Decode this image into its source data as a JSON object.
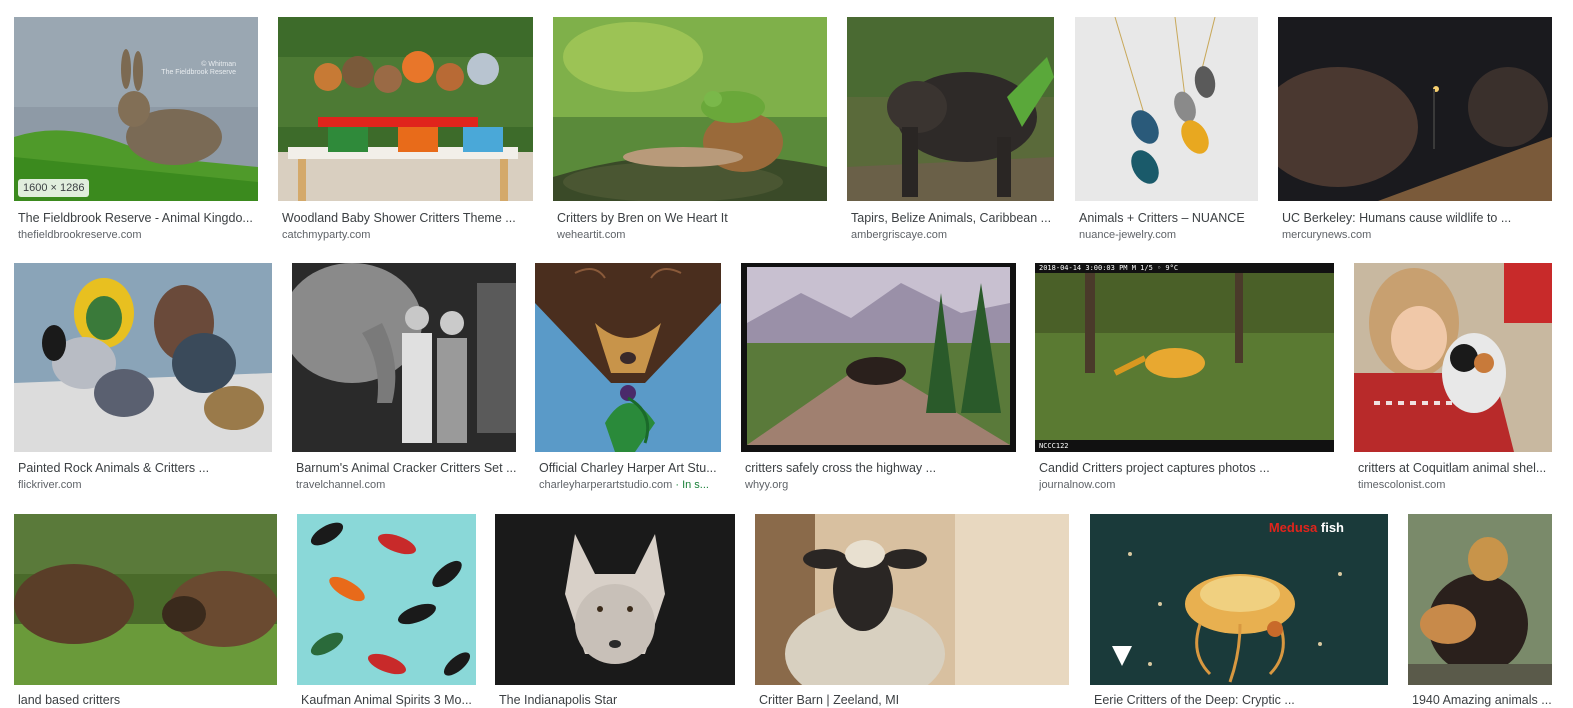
{
  "results": [
    {
      "title": "The Fieldbrook Reserve - Animal Kingdo...",
      "source": "thefieldbrookreserve.com",
      "badge": "1600 × 1286"
    },
    {
      "title": "Woodland Baby Shower Critters Theme ...",
      "source": "catchmyparty.com"
    },
    {
      "title": "Critters by Bren on We Heart It",
      "source": "weheartit.com"
    },
    {
      "title": "Tapirs, Belize Animals, Caribbean ...",
      "source": "ambergriscaye.com"
    },
    {
      "title": "Animals + Critters – NUANCE",
      "source": "nuance-jewelry.com"
    },
    {
      "title": "UC Berkeley: Humans cause wildlife to ...",
      "source": "mercurynews.com"
    },
    {
      "title": "Painted Rock Animals & Critters ...",
      "source": "flickriver.com"
    },
    {
      "title": "Barnum's Animal Cracker Critters Set ...",
      "source": "travelchannel.com"
    },
    {
      "title": "Official Charley Harper Art Stu...",
      "source": "charleyharperartstudio.com",
      "source_extra": " · In s..."
    },
    {
      "title": "critters safely cross the highway ...",
      "source": "whyy.org"
    },
    {
      "title": "Candid Critters project captures photos ...",
      "source": "journalnow.com"
    },
    {
      "title": "critters at Coquitlam animal shel...",
      "source": "timescolonist.com"
    },
    {
      "title": "land based critters",
      "source": ""
    },
    {
      "title": "Kaufman Animal Spirits 3 Mo...",
      "source": ""
    },
    {
      "title": "The Indianapolis Star",
      "source": ""
    },
    {
      "title": "Critter Barn | Zeeland, MI",
      "source": ""
    },
    {
      "title": "Eerie Critters of the Deep: Cryptic ...",
      "source": ""
    },
    {
      "title": "1940 Amazing animals ...",
      "source": ""
    }
  ],
  "overlay_text": {
    "jellyfish_brand_1": "Medusa",
    "jellyfish_brand_2": "fish",
    "trailcam_top": "2018-04-14  3:00:03 PM   M 1/5        ◦  9°C",
    "trailcam_bottom": "NCCC122",
    "rabbit_watermark_1": "© Whitman",
    "rabbit_watermark_2": "The Fieldbrook Reserve"
  }
}
